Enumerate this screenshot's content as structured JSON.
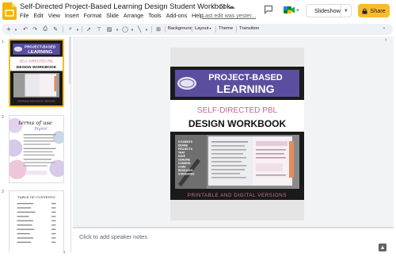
{
  "app": {
    "title": "Self-Directed Project-Based Learning Design Student Workbook",
    "last_edit": "Last edit was yester...",
    "title_icons": [
      "star-icon",
      "move-to-folder-icon",
      "cloud-saved-icon"
    ]
  },
  "menu": [
    "File",
    "Edit",
    "View",
    "Insert",
    "Format",
    "Slide",
    "Arrange",
    "Tools",
    "Add-ons",
    "Help"
  ],
  "header_buttons": {
    "slideshow": "Slideshow",
    "share": "Share",
    "share_icon": "lock-icon"
  },
  "toolbar": {
    "background": "Background",
    "layout": "Layout",
    "theme": "Theme",
    "transition": "Transition"
  },
  "filmstrip": {
    "slides": [
      {
        "number": "1"
      },
      {
        "number": "2",
        "caption_line1": "terms of use",
        "caption_line2": "Digital"
      },
      {
        "number": "3",
        "caption": "TABLE OF CONTENTS"
      }
    ]
  },
  "slide": {
    "title_line1": "PROJECT-BASED",
    "title_line2": "LEARNING",
    "subtitle_line1": "SELF-DIRECTED PBL",
    "subtitle_line2": "DESIGN WORKBOOK",
    "side_text": [
      "STUDENTS",
      "DEFINE",
      "PROJECTS",
      "THAT",
      "HAVE",
      "GENUINE",
      "COMMON",
      "CORE",
      "RESEARCH",
      "STANDARDS"
    ],
    "footer": "PRINTABLE AND DIGITAL VERSIONS"
  },
  "notes": {
    "placeholder": "Click to add speaker notes"
  },
  "colors": {
    "accent_yellow": "#f8bb2a",
    "slide_dark": "#1a1a1a",
    "banner_purple": "#5b4e9e",
    "subtitle_pink": "#c9668a",
    "footer_pink": "#d0709a"
  }
}
